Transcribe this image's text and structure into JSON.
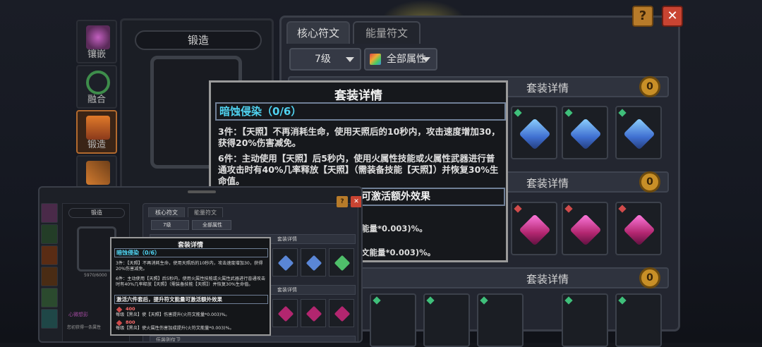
{
  "nav": {
    "items": [
      {
        "label": "镶嵌"
      },
      {
        "label": "融合"
      },
      {
        "label": "锻造"
      },
      {
        "label": ""
      }
    ]
  },
  "forge": {
    "title": "锻造"
  },
  "main": {
    "help_label": "?",
    "close_label": "✕",
    "tabs": [
      {
        "label": "核心符文"
      },
      {
        "label": "能量符文"
      }
    ],
    "level_select": "7级",
    "attr_select": "全部属性",
    "set_bar_label": "套装详情",
    "coin_label": "0"
  },
  "tooltip": {
    "title": "套装详情",
    "set_name": "暗蚀侵染（0/6）",
    "three_piece": "3件：【天照】不再消耗生命，使用天照后的10秒内，攻击速度增加30，获得20%伤害减免。",
    "six_piece": "6件：主动使用【天照】后5秒内，使用火属性技能或火属性武器进行普通攻击时有40%几率释放【天照】（需装备技能【天照】）并恢复30%生命值。",
    "extra_partial": "可激活额外效果",
    "line1_partial": "能量*0.003)%。",
    "line2_partial": "文能量*0.003)%。"
  },
  "inset": {
    "nav_labels": [
      "",
      "",
      "",
      "",
      "",
      ""
    ],
    "forge_title": "锻造",
    "forge_value": "5970/6000",
    "foot_text": "心微想彭",
    "foot_text2": "您初获得一条属性",
    "help": "?",
    "close": "✕",
    "tabs": [
      "核心符文",
      "能量符文"
    ],
    "level_select": "7级",
    "attr_select": "全部属性",
    "set_bar_label": "套装详情",
    "bottom_label": "伍装则仅卫",
    "tooltip": {
      "title": "套装详情",
      "set_name": "暗蚀侵染（0/6）",
      "three_piece": "3件：【天照】不再消耗生命，使用天照后的10秒内，攻击速度增加30，获得20%伤害减免。",
      "six_piece": "6件：主动使用【天照】后5秒内，使用火属性技能或火属性武器进行普通攻击时有40%几率释放【天照】（需装备技能【天照】）并恢复30%生命值。",
      "extra": "激活六件套后，提升符文能量可激活额外效果",
      "req1": "400",
      "line1": "每级【黑炎】使【天照】伤害提升(火符文能量*0.003)%。",
      "req2": "800",
      "line2": "每级【黑炎】使火属性伤害加成提升(火符文能量*0.003)%。"
    }
  },
  "colors": {
    "accent_cyan": "#4fd2f0",
    "help_orange": "#b77b2a",
    "close_red": "#c94432",
    "requirement_red": "#ff6b6b"
  }
}
